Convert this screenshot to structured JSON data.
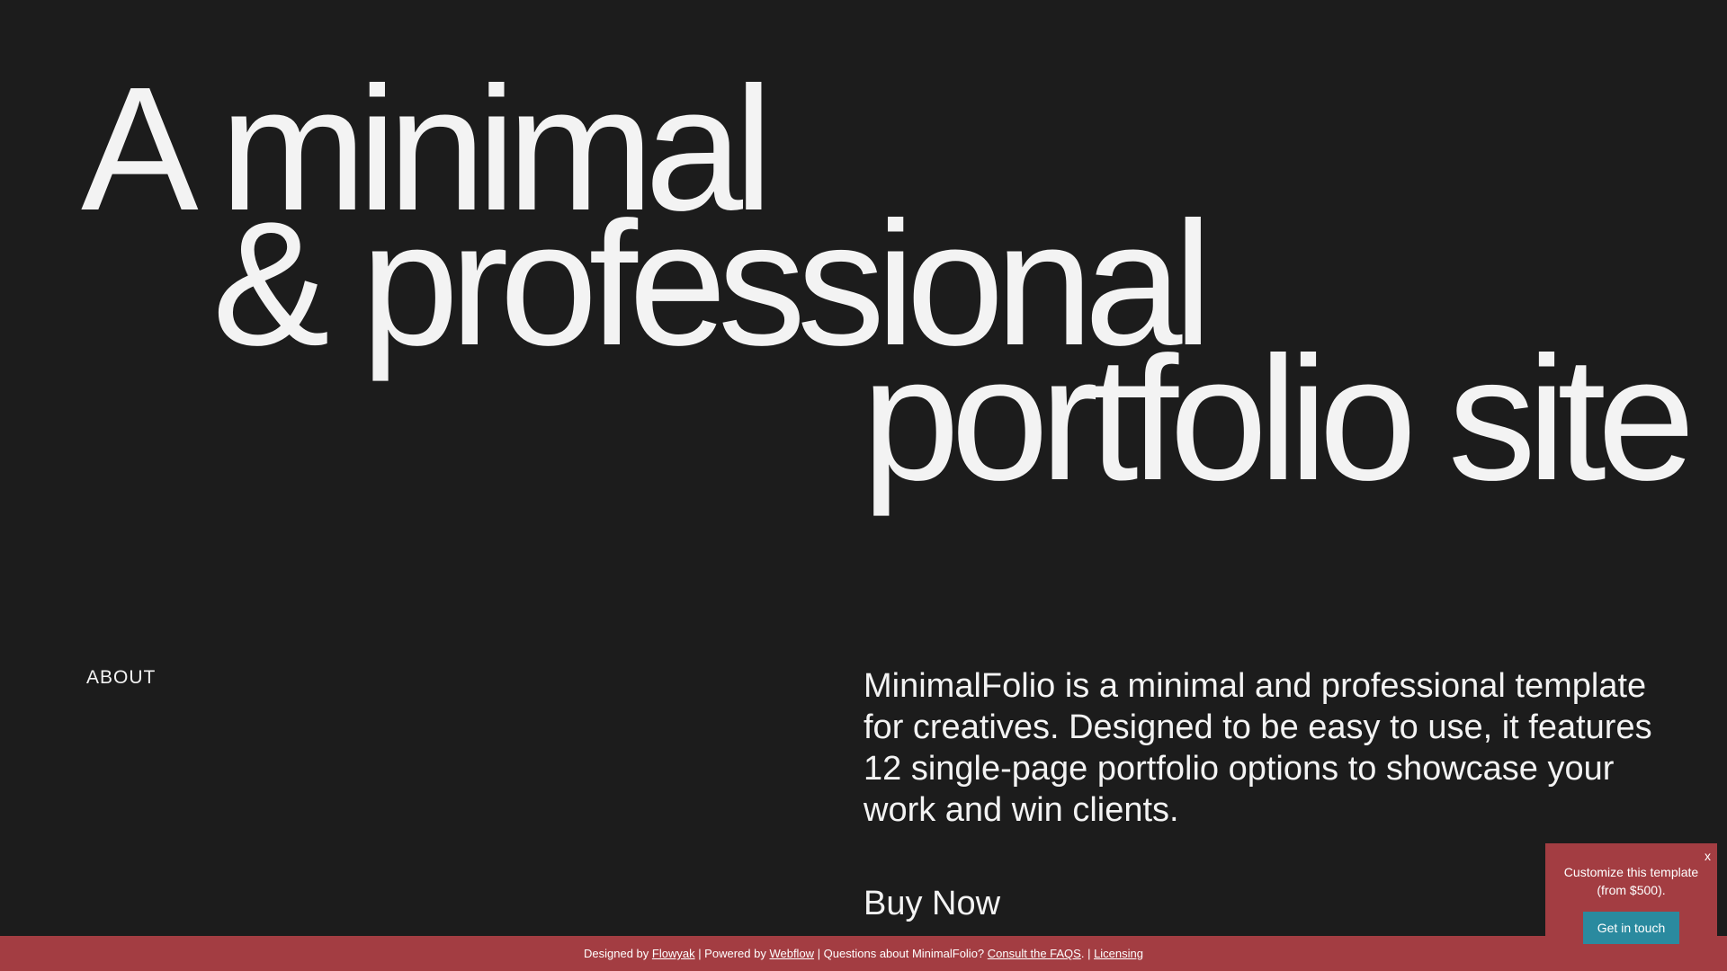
{
  "hero": {
    "line1": "A minimal",
    "line2": "& professional",
    "line3": "portfolio site"
  },
  "about": {
    "label": "ABOUT",
    "text": "MinimalFolio is a minimal and professional template for creatives. Designed to be easy to use, it features 12 single-page portfolio options to showcase your work and win clients.",
    "buy_label": "Buy Now"
  },
  "footer": {
    "designed_by_prefix": "Designed by ",
    "designer_link": "Flowyak",
    "powered_by_prefix": " | Powered by ",
    "platform_link": "Webflow",
    "questions_text": " | Questions about MinimalFolio? ",
    "faq_link": "Consult the FAQS",
    "separator": ". | ",
    "licensing_link": "Licensing"
  },
  "promo": {
    "close_label": "x",
    "text": "Customize this template (from $500).",
    "button_label": "Get in touch"
  },
  "colors": {
    "background": "#1c1c1c",
    "text": "#f3f3f3",
    "accent_red": "#a33d42",
    "button_teal": "#2a8a9f"
  }
}
